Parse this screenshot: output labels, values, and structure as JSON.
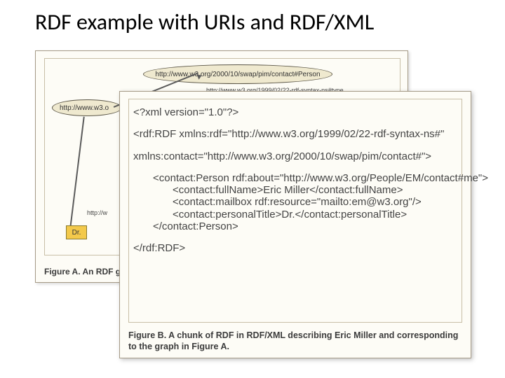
{
  "title": "RDF example with URIs and RDF/XML",
  "figA": {
    "caption": "Figure A. An RDF gra",
    "ellipse_top": "http://www.w3.org/2000/10/swap/pim/contact#Person",
    "ellipse_left": "http://www.w3.o",
    "edge_type": "http://www.w3.org/1999/02/22-rdf-syntax-ns#type",
    "edge_partial": "http://w",
    "box_dr": "Dr."
  },
  "figB": {
    "caption_text": "Figure B. A chunk of RDF in RDF/XML describing Eric Miller and corresponding to the graph in Figure A.",
    "code": {
      "l1": "<?xml version=\"1.0\"?>",
      "l2": "<rdf:RDF xmlns:rdf=\"http://www.w3.org/1999/02/22-rdf-syntax-ns#\"",
      "l3": "xmlns:contact=\"http://www.w3.org/2000/10/swap/pim/contact#\">",
      "l4": "<contact:Person rdf:about=\"http://www.w3.org/People/EM/contact#me\">",
      "l5": "<contact:fullName>Eric Miller</contact:fullName>",
      "l6": "<contact:mailbox rdf:resource=\"mailto:em@w3.org\"/>",
      "l7": "<contact:personalTitle>Dr.</contact:personalTitle>",
      "l8": "</contact:Person>",
      "l9": "</rdf:RDF>"
    }
  }
}
